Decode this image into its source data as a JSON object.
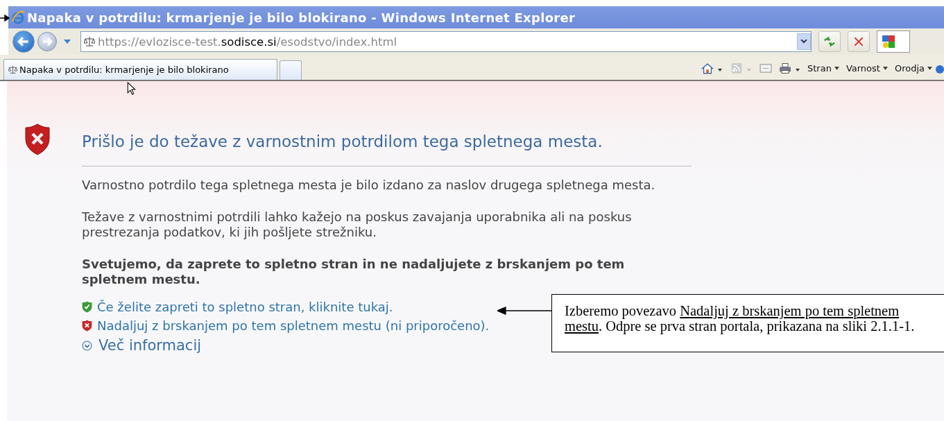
{
  "window": {
    "title": "Napaka v potrdilu: krmarjenje je bilo blokirano - Windows Internet Explorer"
  },
  "address_bar": {
    "url_parts": [
      {
        "text": "https://evlozisce-test.",
        "emphasis": false
      },
      {
        "text": "sodisce.si",
        "emphasis": true
      },
      {
        "text": "/esodstvo/index.html",
        "emphasis": false
      }
    ]
  },
  "tabs": [
    {
      "label": "Napaka v potrdilu: krmarjenje je bilo blokirano",
      "selected": true
    }
  ],
  "command_bar": {
    "menus": [
      "Stran",
      "Varnost",
      "Orodja"
    ]
  },
  "page": {
    "heading": "Prišlo je do težave z varnostnim potrdilom tega spletnega mesta.",
    "paragraphs": [
      "Varnostno potrdilo tega spletnega mesta je bilo izdano za naslov drugega spletnega mesta.",
      "Težave z varnostnimi potrdili lahko kažejo na poskus zavajanja uporabnika ali na poskus prestrezanja podatkov, ki jih pošljete strežniku."
    ],
    "advice": "Svetujemo, da zaprete to spletno stran in ne nadaljujete z brskanjem po tem spletnem mestu.",
    "links": [
      {
        "kind": "safe",
        "text": "Če želite zapreti to spletno stran, kliknite tukaj."
      },
      {
        "kind": "unsafe",
        "text": "Nadaljuj z brskanjem po tem spletnem mestu (ni priporočeno)."
      }
    ],
    "more_info": {
      "label": "Več informacij",
      "expanded": false
    }
  },
  "callout": {
    "parts": [
      {
        "text": "Izberemo povezavo ",
        "underline": false
      },
      {
        "text": "Nadaljuj z brskanjem po tem spletnem mestu",
        "underline": true
      },
      {
        "text": ". Odpre se prva stran portala, prikazana na sliki 2.1.1-1.",
        "underline": false
      }
    ]
  }
}
